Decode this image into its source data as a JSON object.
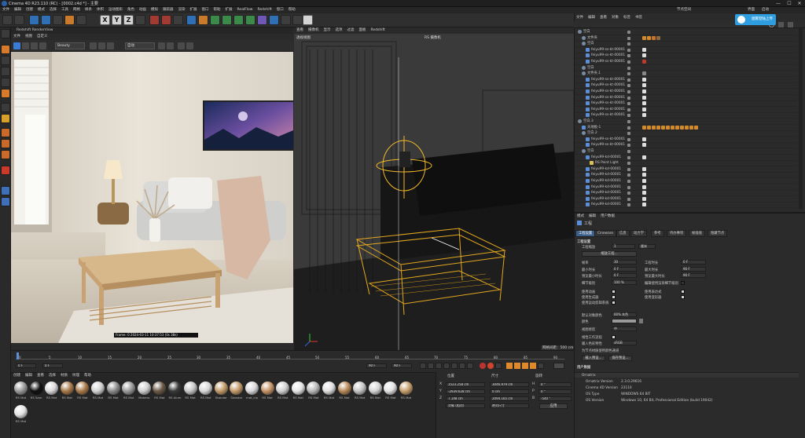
{
  "window": {
    "title": "Cinema 4D R23.110 (RC) - [0002.c4d *] - 主要",
    "controls": [
      "—",
      "☐",
      "✕"
    ]
  },
  "menubar": {
    "items": [
      "文件",
      "编辑",
      "创建",
      "模式",
      "选择",
      "工具",
      "网格",
      "样条",
      "体积",
      "运动图形",
      "角色",
      "动画",
      "模拟",
      "跟踪器",
      "渲染",
      "扩展",
      "窗口",
      "帮助",
      "扩展",
      "RealFlow",
      "Redshift",
      "窗口",
      "帮助"
    ],
    "right_label": "节点空间",
    "layout_select": "启动 (Redshift)",
    "right_items": [
      "界面",
      "启动"
    ]
  },
  "toolbar": {
    "axis_buttons": [
      "X",
      "Y",
      "Z"
    ]
  },
  "render_view": {
    "title": "Redshift RenderView",
    "menu": [
      "文件",
      "视图",
      "自定义"
    ],
    "beauty_select": "Beauty",
    "camera_select": "自动",
    "stamp": "Frame: 0   2024-03-11  10:37:53  (0s 38s)"
  },
  "viewport": {
    "menu": [
      "查看",
      "摄像机",
      "显示",
      "选项",
      "过滤",
      "面板",
      "Redshift"
    ],
    "view_name": "透视视图",
    "camera_label": "RS 摄像机",
    "grid_label": "网格间距：500 cm"
  },
  "timeline": {
    "ticks": [
      "0",
      "5",
      "10",
      "15",
      "20",
      "25",
      "30",
      "35",
      "40",
      "45",
      "50",
      "55",
      "60",
      "65",
      "70",
      "75",
      "80",
      "85",
      "90"
    ],
    "start": "0 F",
    "current": "0 F",
    "end": "90 F",
    "end2": "90 F",
    "frame": "0 F"
  },
  "materials": {
    "tabs": [
      "创建",
      "编辑",
      "查看",
      "选择",
      "材质",
      "纹理",
      "帮助"
    ],
    "items": [
      {
        "name": "RS Mat",
        "color": "#9a9a9a"
      },
      {
        "name": "RS Sam",
        "color": "#111111"
      },
      {
        "name": "RS Mat",
        "color": "#d9d9d9"
      },
      {
        "name": "RS Mat",
        "color": "#a87a4a"
      },
      {
        "name": "RS Mat",
        "color": "#a87a4a"
      },
      {
        "name": "RS Mat",
        "color": "#d2d2d2"
      },
      {
        "name": "RS Mat",
        "color": "#8b8b8b"
      },
      {
        "name": "RS Mat",
        "color": "#9a9a9a"
      },
      {
        "name": "Materia",
        "color": "#cfcfcf"
      },
      {
        "name": "RS Mat",
        "color": "#6c5a48"
      },
      {
        "name": "RS Alum",
        "color": "#3a3a3a"
      },
      {
        "name": "RS Mat",
        "color": "#c7c7c7"
      },
      {
        "name": "RS Mat",
        "color": "#d8d8d8"
      },
      {
        "name": "Standar",
        "color": "#c29a6a"
      },
      {
        "name": "Standar",
        "color": "#c29a6a"
      },
      {
        "name": "mat_cip",
        "color": "#d8d8d8"
      },
      {
        "name": "RS Mat",
        "color": "#c49468"
      },
      {
        "name": "RS Mat",
        "color": "#d0d0d0"
      },
      {
        "name": "RS Mat",
        "color": "#e6e6e6"
      },
      {
        "name": "RS Mat",
        "color": "#b8b8b8"
      },
      {
        "name": "RS Mat",
        "color": "#e0e0e0"
      },
      {
        "name": "RS Mat",
        "color": "#b68a5a"
      },
      {
        "name": "RS Mat",
        "color": "#c5c5c5"
      },
      {
        "name": "RS Mat",
        "color": "#d6d6d6"
      },
      {
        "name": "RS Mat",
        "color": "#e3e3e3"
      },
      {
        "name": "RS Mat",
        "color": "#c89e6e"
      },
      {
        "name": "RS Mat",
        "color": "#e4e4e4"
      }
    ]
  },
  "coordinates": {
    "headers": [
      "位置",
      "尺寸",
      "旋转"
    ],
    "rows": [
      {
        "axis": "X",
        "pos": "1523.258 cm",
        "size": "3046.979 cm",
        "rot_axis": "H",
        "rot": "0 °"
      },
      {
        "axis": "Y",
        "pos": "-2939.628 cm",
        "size": "0 cm",
        "rot_axis": "P",
        "rot": "0 °"
      },
      {
        "axis": "Z",
        "pos": "7.148 cm",
        "size": "2094.165 cm",
        "rot_axis": "B",
        "rot": "-540 °"
      }
    ],
    "mode_select": "对象 (相对)",
    "size_select": "绝对尺寸",
    "apply": "应用"
  },
  "object_manager": {
    "menu": [
      "文件",
      "编辑",
      "查看",
      "对象",
      "标签",
      "书签"
    ],
    "cloud_button": "烟雾登陆上传",
    "rows": [
      {
        "name": "空白",
        "indent": 0,
        "icon": "null",
        "tags": []
      },
      {
        "name": "文件夹",
        "indent": 1,
        "icon": "null",
        "tags": [
          "#d28a2a",
          "#d28a2a",
          "#c9742a",
          "#8a6a3a"
        ]
      },
      {
        "name": "空白",
        "indent": 1,
        "icon": "null",
        "tags": []
      },
      {
        "name": "feiyu99-ss-kt-00001",
        "indent": 2,
        "icon": "mesh",
        "tags": [
          "#dddddd"
        ]
      },
      {
        "name": "feiyu99-ss-kt-00001",
        "indent": 2,
        "icon": "mesh",
        "tags": [
          "#dddddd"
        ]
      },
      {
        "name": "feiyu99-ss-kt-00001",
        "indent": 2,
        "icon": "mesh",
        "tags": [
          "#c0392b"
        ]
      },
      {
        "name": "空白",
        "indent": 1,
        "icon": "null",
        "tags": []
      },
      {
        "name": "文件夹.1",
        "indent": 1,
        "icon": "null",
        "tags": [
          "#888888"
        ]
      },
      {
        "name": "feiyu99-ss-kt-00001",
        "indent": 2,
        "icon": "mesh",
        "tags": [
          "#dddddd"
        ]
      },
      {
        "name": "feiyu99-ss-kt-00001",
        "indent": 2,
        "icon": "mesh",
        "tags": [
          "#dddddd"
        ]
      },
      {
        "name": "feiyu99-ss-kt-00001",
        "indent": 2,
        "icon": "mesh",
        "tags": [
          "#dddddd"
        ]
      },
      {
        "name": "feiyu99-ss-kt-00001",
        "indent": 2,
        "icon": "mesh",
        "tags": [
          "#dddddd"
        ]
      },
      {
        "name": "feiyu99-ss-kt-00001",
        "indent": 2,
        "icon": "mesh",
        "tags": [
          "#dddddd"
        ]
      },
      {
        "name": "feiyu99-ss-kt-00001",
        "indent": 2,
        "icon": "mesh",
        "tags": [
          "#dddddd"
        ]
      },
      {
        "name": "feiyu99-ss-kt-00001",
        "indent": 2,
        "icon": "mesh",
        "tags": [
          "#dddddd"
        ]
      },
      {
        "name": "空白.3",
        "indent": 0,
        "icon": "null",
        "tags": []
      },
      {
        "name": "天地板-1",
        "indent": 1,
        "icon": "mesh",
        "tags": [
          "#d28a2a",
          "#d28a2a",
          "#d28a2a",
          "#d28a2a",
          "#d28a2a",
          "#d28a2a",
          "#d28a2a",
          "#d28a2a",
          "#d28a2a",
          "#d28a2a",
          "#d28a2a",
          "#d28a2a"
        ]
      },
      {
        "name": "空白.2",
        "indent": 1,
        "icon": "null",
        "tags": []
      },
      {
        "name": "feiyu99-ss-kt-00001",
        "indent": 2,
        "icon": "mesh",
        "tags": [
          "#dddddd"
        ]
      },
      {
        "name": "feiyu99-ss-kt-00001",
        "indent": 2,
        "icon": "mesh",
        "tags": [
          "#dddddd"
        ]
      },
      {
        "name": "空白",
        "indent": 1,
        "icon": "null",
        "tags": []
      },
      {
        "name": "feiyu99-kd-00001",
        "indent": 2,
        "icon": "mesh",
        "tags": [
          "#dddddd"
        ]
      },
      {
        "name": "RS Point Light",
        "indent": 3,
        "icon": "light",
        "tags": []
      },
      {
        "name": "feiyu99-kd-00001",
        "indent": 2,
        "icon": "mesh",
        "tags": [
          "#dddddd"
        ]
      },
      {
        "name": "feiyu99-kd-00001",
        "indent": 2,
        "icon": "mesh",
        "tags": [
          "#dddddd"
        ]
      },
      {
        "name": "feiyu99-kd-00001",
        "indent": 2,
        "icon": "mesh",
        "tags": [
          "#dddddd"
        ]
      },
      {
        "name": "feiyu99-kd-00001",
        "indent": 2,
        "icon": "mesh",
        "tags": [
          "#dddddd"
        ]
      },
      {
        "name": "feiyu99-kd-00001",
        "indent": 2,
        "icon": "mesh",
        "tags": [
          "#dddddd"
        ]
      },
      {
        "name": "feiyu99-kd-00001",
        "indent": 2,
        "icon": "mesh",
        "tags": [
          "#dddddd"
        ]
      },
      {
        "name": "feiyu99-kd-00001",
        "indent": 2,
        "icon": "mesh",
        "tags": [
          "#dddddd"
        ]
      }
    ]
  },
  "attributes": {
    "menu": [
      "模式",
      "编辑",
      "用户数据"
    ],
    "title": "工程",
    "tabs": [
      "工程设置",
      "Cineware",
      "信息",
      "动力学",
      "参考",
      "待办事项",
      "帧插值",
      "隐藏节点"
    ],
    "section": "工程设置",
    "scale_label": "工程缩放",
    "scale_value": "1",
    "scale_unit": "厘米",
    "scale_button": "缩放工程...",
    "fields": [
      {
        "label": "帧率",
        "value": "30",
        "label2": "工程时长",
        "value2": "0 F"
      },
      {
        "label": "最小时长",
        "value": "0 F",
        "label2": "最大时长",
        "value2": "90 F"
      },
      {
        "label": "预览最小时长",
        "value": "0 F",
        "label2": "预览最大时长",
        "value2": "90 F"
      },
      {
        "label": "细节级别",
        "value": "100 %",
        "label2": "编辑使用渲染细节级别",
        "value2": ""
      }
    ],
    "checks": [
      {
        "label": "使用动画",
        "label2": "使用表达式"
      },
      {
        "label": "使用生成器",
        "label2": "使用变形器"
      },
      {
        "label": "使用运动剪辑系统",
        "label2": ""
      }
    ],
    "default_color_label": "默认对象颜色",
    "default_color_value": "60% 灰色",
    "color_label": "颜色",
    "view_clip_label": "视图修剪",
    "view_clip_value": "中",
    "linear_label": "线性工作流程",
    "input_color_label": "输入色彩特性",
    "input_color_value": "sRGB",
    "vertex_color_label": "为节点材质使用颜色通道",
    "buttons": [
      "载入预设...",
      "保存预设..."
    ],
    "user_data": "用户数据",
    "ornatrix_label": "Ornatrix",
    "info": [
      {
        "label": "Ornatrix Version",
        "value": "2.3.0.29616"
      },
      {
        "label": "Cinema 4D Version",
        "value": "23110"
      },
      {
        "label": "OS Type",
        "value": "WINDOWS 64 BIT"
      },
      {
        "label": "OS Version",
        "value": "Windows 10, 64 Bit, Professional Edition (build 19042)"
      }
    ]
  }
}
